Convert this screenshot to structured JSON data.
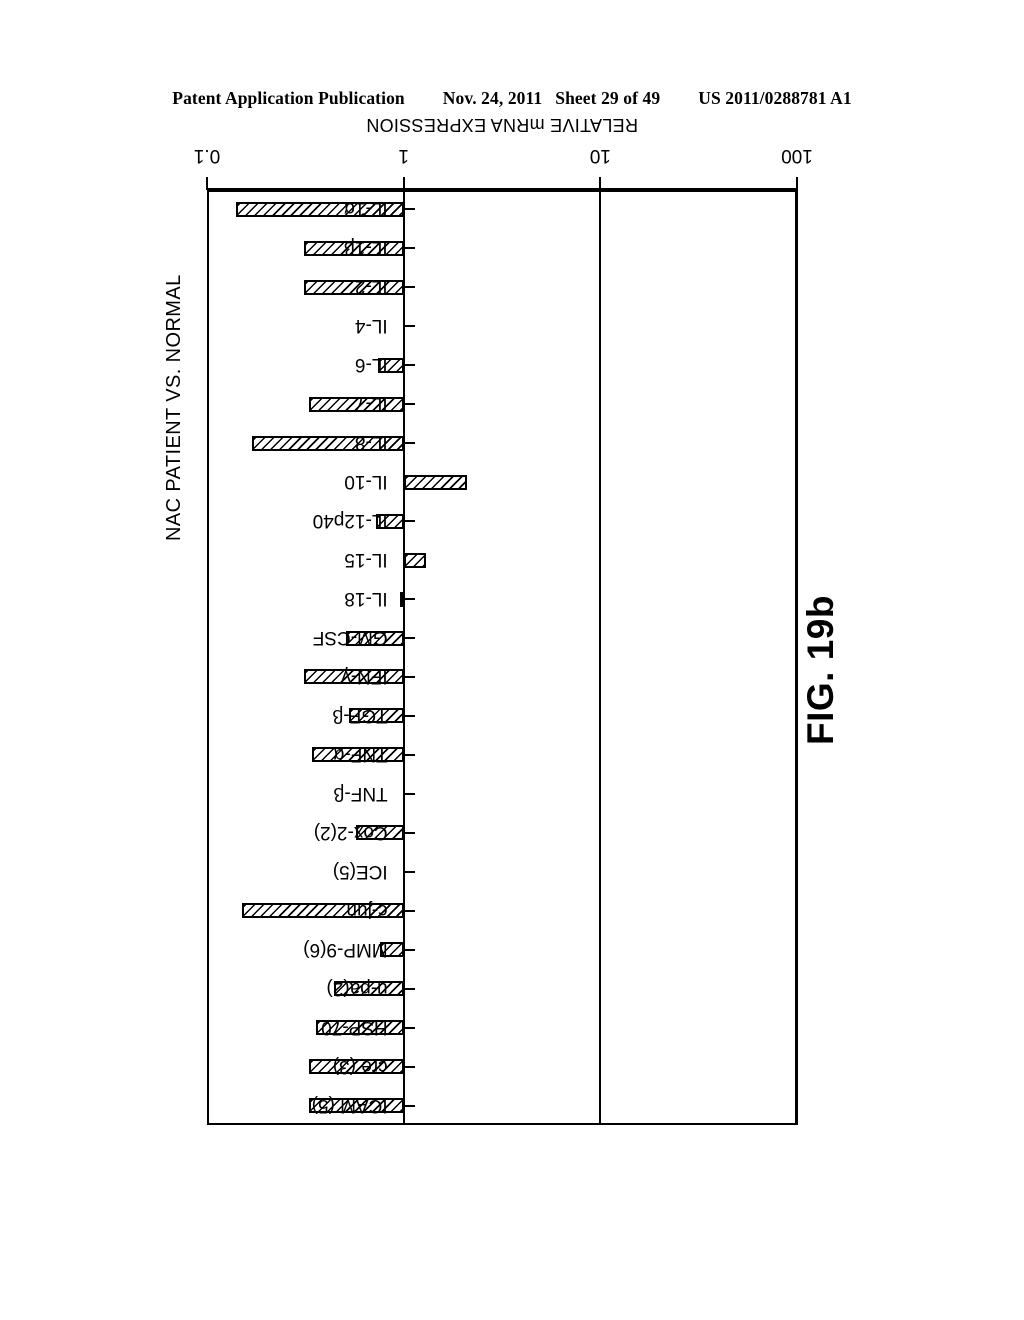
{
  "header": {
    "publication": "Patent Application Publication",
    "date": "Nov. 24, 2011",
    "sheet": "Sheet 29 of 49",
    "number": "US 2011/0288781 A1"
  },
  "figure": {
    "caption": "FIG. 19b"
  },
  "chart_data": {
    "type": "bar",
    "orientation": "horizontal",
    "title": "NAC PATIENT VS. NORMAL",
    "xlabel": "RELATIVE mRNA EXPRESSION",
    "ylabel": "",
    "scale": "log",
    "xlim": [
      0.1,
      100
    ],
    "tick_labels": [
      "100",
      "10",
      "1",
      "0.1"
    ],
    "tick_values": [
      100,
      10,
      1,
      0.1
    ],
    "grid": true,
    "gridlines": [
      100,
      10,
      1
    ],
    "baseline": 1,
    "legend": "none",
    "rotated_180": true,
    "categories": [
      "IL-1α",
      "IL-1β",
      "IL-2",
      "IL-4",
      "IL-6",
      "IL-7",
      "IL-8",
      "IL-10",
      "IL-12p40",
      "IL-15",
      "IL-18",
      "GM-CSF",
      "IFN-γ",
      "TGF-β",
      "TNF-α",
      "TNF-β",
      "Cox-2(2)",
      "ICE(5)",
      "c-jun",
      "MMP-9(6)",
      "u-pa(2)",
      "HSP-70",
      "cre (3)",
      "ICAM (5)"
    ],
    "values": [
      0.14,
      0.31,
      0.31,
      1.0,
      0.74,
      0.33,
      0.17,
      2.1,
      0.72,
      1.3,
      0.99,
      0.51,
      0.31,
      0.53,
      0.34,
      1.0,
      0.57,
      1.0,
      0.15,
      0.76,
      0.44,
      0.36,
      0.33,
      0.33
    ],
    "series": [
      {
        "name": "NAC patient vs. normal",
        "values": [
          0.14,
          0.31,
          0.31,
          1.0,
          0.74,
          0.33,
          0.17,
          2.1,
          0.72,
          1.3,
          0.99,
          0.51,
          0.31,
          0.53,
          0.34,
          1.0,
          0.57,
          1.0,
          0.15,
          0.76,
          0.44,
          0.36,
          0.33,
          0.33
        ]
      }
    ]
  }
}
